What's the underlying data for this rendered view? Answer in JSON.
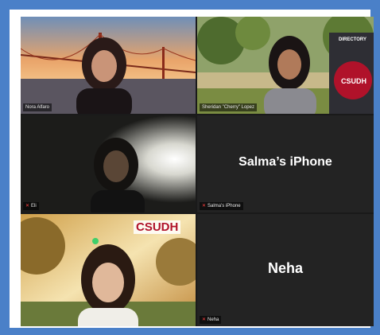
{
  "participants": [
    {
      "id": "nora",
      "label": "Nora Alfaro",
      "muted": false
    },
    {
      "id": "cherry",
      "label": "Sheridan \"Cherry\" Lopez",
      "muted": false,
      "speaking": true
    },
    {
      "id": "eli",
      "label": "Eli",
      "muted": true
    },
    {
      "id": "salma",
      "display_name": "Salma’s iPhone",
      "label": "Salma’s iPhone",
      "muted": true
    },
    {
      "id": "bottom-left",
      "logo": "CSUDH"
    },
    {
      "id": "neha",
      "display_name": "Neha",
      "label": "Neha",
      "muted": true
    }
  ],
  "backgrounds": {
    "directory_sign": "DIRECTORY",
    "csudh_sign": "CSUDH"
  },
  "colors": {
    "outer_border": "#4a80c8",
    "tile_bg": "#232323",
    "active_speaker": "#3fcf6a",
    "muted_mic": "#ff4040",
    "csudh_red": "#b0122a",
    "csudh_gold": "#f2b51b"
  },
  "icons": {
    "muted": "mic-muted-icon"
  }
}
